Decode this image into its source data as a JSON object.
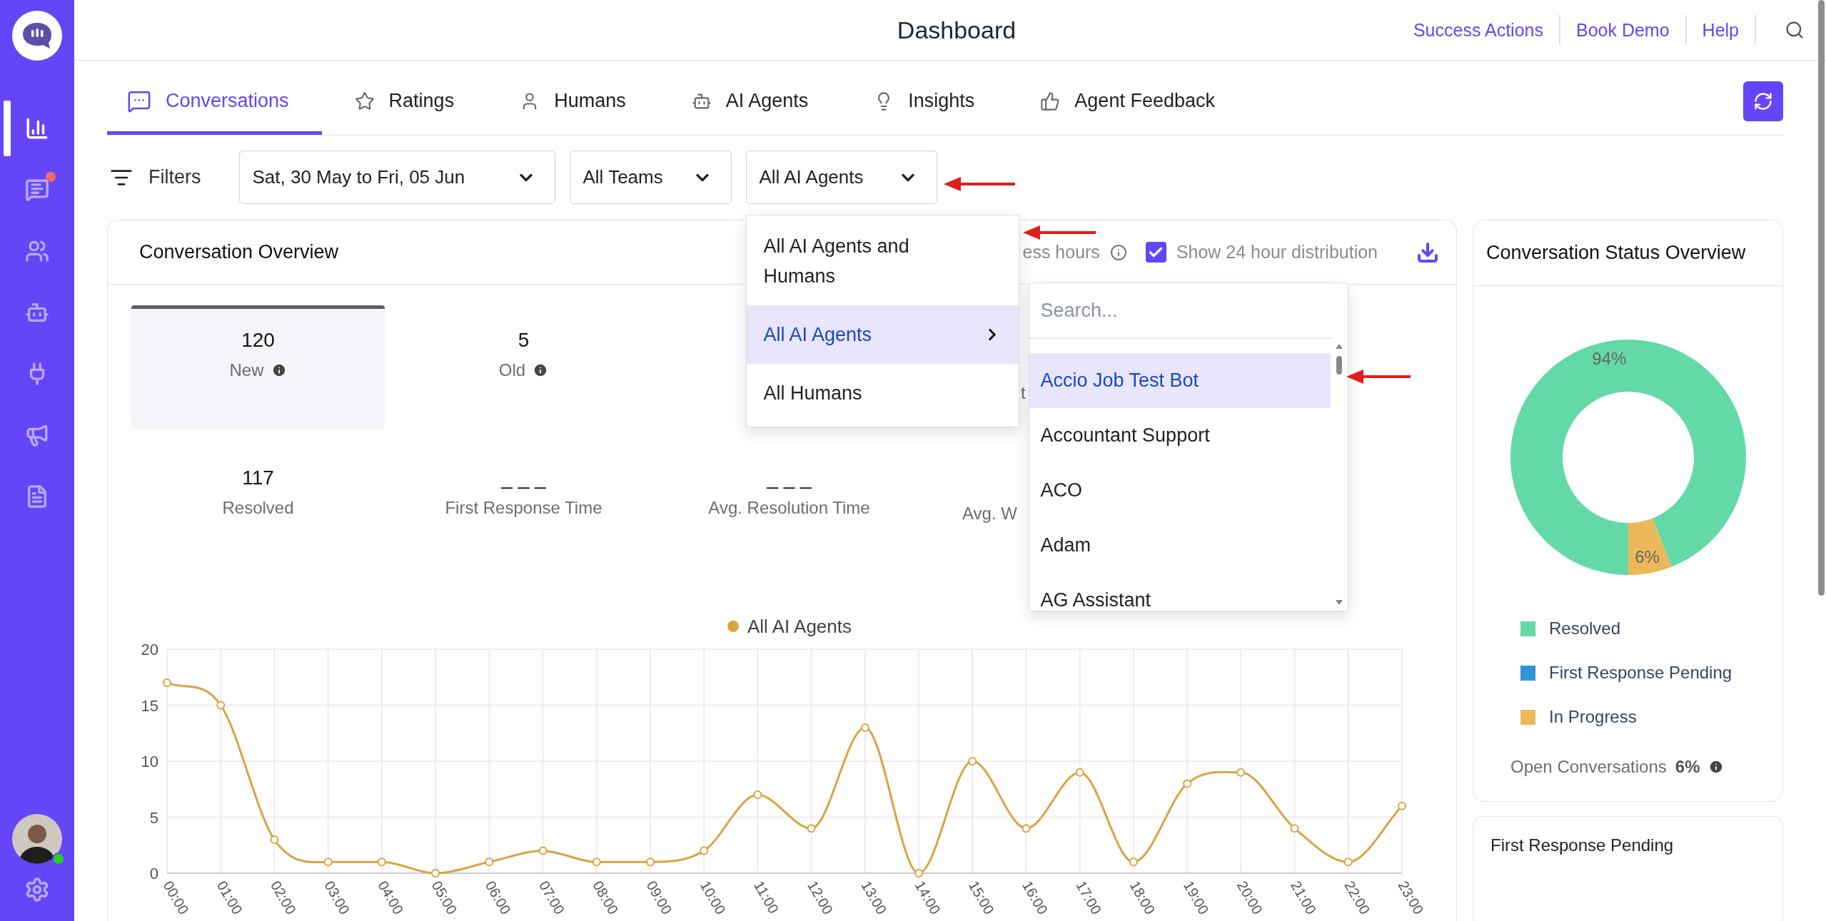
{
  "sidebar": {
    "items": [
      {
        "kind": "chart",
        "selected": true,
        "badge": false
      },
      {
        "kind": "messages",
        "selected": false,
        "badge": true
      },
      {
        "kind": "users",
        "selected": false,
        "badge": false
      },
      {
        "kind": "bot",
        "selected": false,
        "badge": false
      },
      {
        "kind": "plug",
        "selected": false,
        "badge": false
      },
      {
        "kind": "megaphone",
        "selected": false,
        "badge": false
      },
      {
        "kind": "document",
        "selected": false,
        "badge": false
      }
    ],
    "user": {
      "online": true
    }
  },
  "header": {
    "title": "Dashboard",
    "links": [
      "Success Actions",
      "Book Demo",
      "Help"
    ]
  },
  "tabs": [
    {
      "kind": "chat",
      "label": "Conversations",
      "selected": true
    },
    {
      "kind": "star",
      "label": "Ratings",
      "selected": false
    },
    {
      "kind": "person",
      "label": "Humans",
      "selected": false
    },
    {
      "kind": "bot",
      "label": "AI Agents",
      "selected": false
    },
    {
      "kind": "bulb",
      "label": "Insights",
      "selected": false
    },
    {
      "kind": "thumb",
      "label": "Agent Feedback",
      "selected": false
    }
  ],
  "filters": {
    "label": "Filters",
    "selects": [
      {
        "value": "Sat, 30 May to Fri, 05 Jun"
      },
      {
        "value": "All Teams"
      },
      {
        "value": "All AI Agents",
        "menu": {
          "options": [
            {
              "label": "All AI Agents and Humans",
              "selected": false,
              "submenu": false
            },
            {
              "label": "All AI Agents",
              "selected": true,
              "submenu": true
            },
            {
              "label": "All Humans",
              "selected": false,
              "submenu": false
            }
          ],
          "submenu": {
            "search": {
              "placeholder": "Search..."
            },
            "items": [
              {
                "label": "Accio Job Test Bot",
                "selected": true
              },
              {
                "label": "Accountant Support",
                "selected": false
              },
              {
                "label": "ACO",
                "selected": false
              },
              {
                "label": "Adam",
                "selected": false
              },
              {
                "label": "AG Assistant",
                "selected": false
              }
            ]
          }
        }
      }
    ]
  },
  "overview": {
    "title": "Conversation Overview",
    "business_hours_label": "ess hours",
    "show_24h": {
      "label": "Show 24 hour distribution",
      "checked": true
    },
    "metric_rows": [
      [
        {
          "kind": "metric",
          "value": "120",
          "label": "New",
          "info": true,
          "selected": true
        },
        {
          "kind": "metric",
          "value": "5",
          "label": "Old",
          "info": true,
          "selected": false
        },
        {
          "kind": "cut",
          "label": "t"
        }
      ],
      [
        {
          "kind": "metric",
          "value": "117",
          "label": "Resolved",
          "info": false,
          "selected": false
        },
        {
          "kind": "metric",
          "value": "_ _ _",
          "label": "First Response Time",
          "info": false,
          "selected": false
        },
        {
          "kind": "metric",
          "value": "_ _ _",
          "label": "Avg. Resolution Time",
          "info": false,
          "selected": false
        },
        {
          "kind": "cut",
          "label": "Avg. W"
        }
      ]
    ],
    "chart_data": {
      "type": "line",
      "grid": true,
      "categories": [
        "00:00",
        "01:00",
        "02:00",
        "03:00",
        "04:00",
        "05:00",
        "06:00",
        "07:00",
        "08:00",
        "09:00",
        "10:00",
        "11:00",
        "12:00",
        "13:00",
        "14:00",
        "15:00",
        "16:00",
        "17:00",
        "18:00",
        "19:00",
        "20:00",
        "21:00",
        "22:00",
        "23:00"
      ],
      "series": [
        {
          "name": "All AI Agents",
          "color": "#d9a441",
          "marker": "circle",
          "values": [
            17,
            15,
            3,
            1,
            1,
            0,
            1,
            2,
            1,
            1,
            2,
            7,
            4,
            13,
            0,
            10,
            4,
            9,
            1,
            8,
            9,
            4,
            1,
            6
          ]
        }
      ],
      "ylim": [
        0,
        20
      ],
      "yticks": [
        0,
        5,
        10,
        15,
        20
      ]
    }
  },
  "status_card": {
    "title": "Conversation Status Overview",
    "chart_data": {
      "type": "donut",
      "categories": [
        "Resolved",
        "First Response Pending",
        "In Progress"
      ],
      "values": [
        94,
        0,
        6
      ],
      "value_labels": [
        "94%",
        null,
        "6%"
      ]
    },
    "legend": [
      {
        "color": "#64d9a8"
      },
      {
        "color": "#2f95d4"
      },
      {
        "color": "#ecb85a"
      }
    ],
    "open_conversations": {
      "label": "Open Conversations",
      "value": "6%"
    }
  },
  "pending_card": {
    "title": "First Response Pending"
  }
}
